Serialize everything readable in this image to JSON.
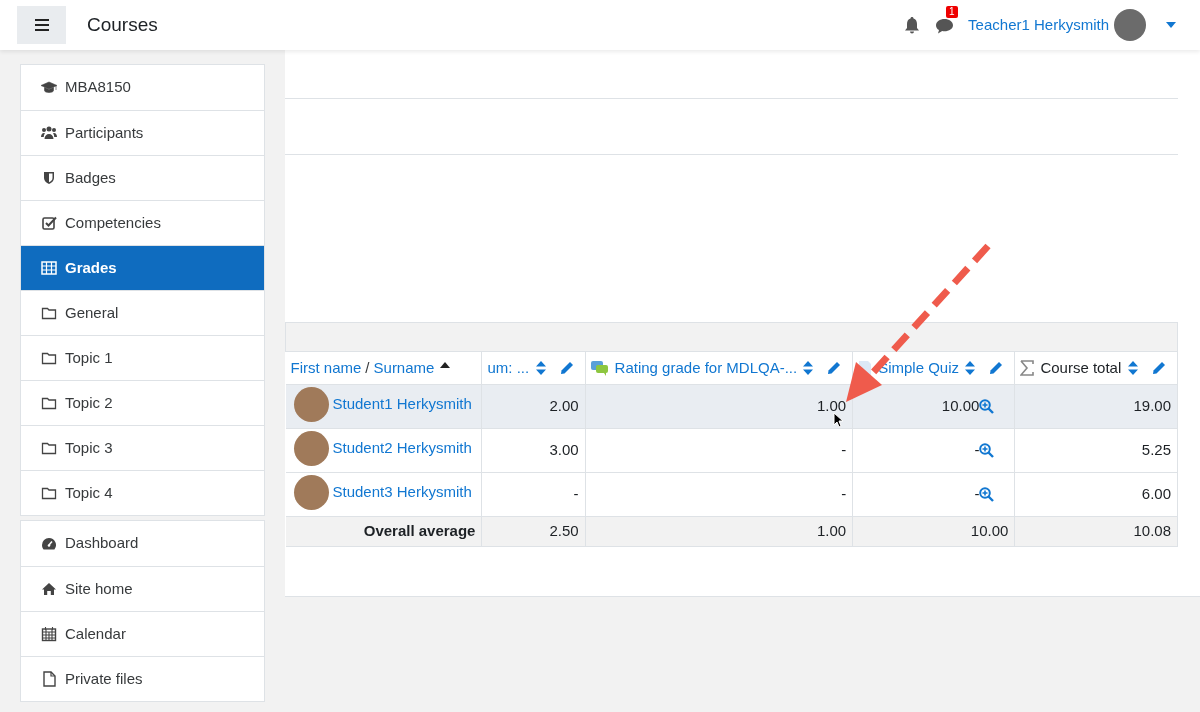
{
  "header": {
    "title": "Courses",
    "messages_count": "1",
    "user_name": "Teacher1 Herkysmith"
  },
  "nav_groups": [
    [
      {
        "label": "MBA8150",
        "selected": false
      },
      {
        "label": "Participants",
        "selected": false
      },
      {
        "label": "Badges",
        "selected": false
      },
      {
        "label": "Competencies",
        "selected": false
      },
      {
        "label": "Grades",
        "selected": true
      },
      {
        "label": "General",
        "selected": false
      },
      {
        "label": "Topic 1",
        "selected": false
      },
      {
        "label": "Topic 2",
        "selected": false
      },
      {
        "label": "Topic 3",
        "selected": false
      },
      {
        "label": "Topic 4",
        "selected": false
      }
    ],
    [
      {
        "label": "Dashboard",
        "selected": false
      },
      {
        "label": "Site home",
        "selected": false
      },
      {
        "label": "Calendar",
        "selected": false
      },
      {
        "label": "Private files",
        "selected": false
      }
    ]
  ],
  "grader_table": {
    "name_header": {
      "first": "First name",
      "separator": "/",
      "last": "Surname"
    },
    "columns": [
      {
        "label": "um: ...",
        "kind": "plain"
      },
      {
        "label": "Rating grade for MDLQA-...",
        "kind": "rating"
      },
      {
        "label": "Simple Quiz",
        "kind": "quiz"
      },
      {
        "label": "Course total",
        "kind": "total"
      }
    ],
    "rows": [
      {
        "name": "Student1 Herkysmith",
        "cells": [
          "2.00",
          "1.00",
          "10.00",
          "19.00"
        ],
        "highlighted": true
      },
      {
        "name": "Student2 Herkysmith",
        "cells": [
          "3.00",
          "-",
          "-",
          "5.25"
        ],
        "highlighted": false
      },
      {
        "name": "Student3 Herkysmith",
        "cells": [
          "-",
          "-",
          "-",
          "6.00"
        ],
        "highlighted": false
      }
    ],
    "average": {
      "label": "Overall average",
      "cells": [
        "2.50",
        "1.00",
        "10.00",
        "10.08"
      ]
    }
  }
}
